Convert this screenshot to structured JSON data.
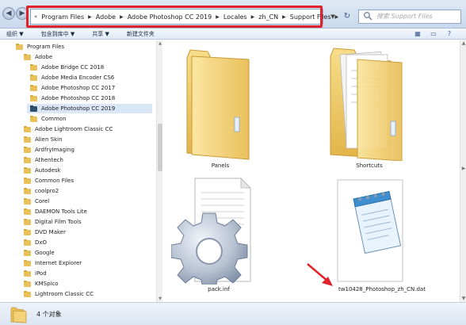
{
  "address": {
    "crumbs": [
      "Program Files",
      "Adobe",
      "Adobe Photoshop CC 2019",
      "Locales",
      "zh_CN",
      "Support Files"
    ]
  },
  "search": {
    "placeholder": "搜索 Support Files"
  },
  "toolbar": {
    "organize": "组织 ▼",
    "include_library": "包含到库中 ▼",
    "share": "共享 ▼",
    "new_folder": "新建文件夹"
  },
  "nav": {
    "items": [
      {
        "label": "Program Files",
        "level": 0
      },
      {
        "label": "Adobe",
        "level": 1
      },
      {
        "label": "Adobe Bridge CC 2018",
        "level": 2
      },
      {
        "label": "Adobe Media Encoder CS6",
        "level": 2
      },
      {
        "label": "Adobe Photoshop CC 2017",
        "level": 2
      },
      {
        "label": "Adobe Photoshop CC 2018",
        "level": 2
      },
      {
        "label": "Adobe Photoshop CC 2019",
        "level": 2,
        "selected": true
      },
      {
        "label": "Common",
        "level": 2
      },
      {
        "label": "Adobe Lightroom Classic CC",
        "level": 1
      },
      {
        "label": "Alien Skin",
        "level": 1
      },
      {
        "label": "ArdfryImaging",
        "level": 1
      },
      {
        "label": "Athentech",
        "level": 1
      },
      {
        "label": "Autodesk",
        "level": 1
      },
      {
        "label": "Common Files",
        "level": 1
      },
      {
        "label": "coolpro2",
        "level": 1
      },
      {
        "label": "Corel",
        "level": 1
      },
      {
        "label": "DAEMON Tools Lite",
        "level": 1
      },
      {
        "label": "Digital Film Tools",
        "level": 1
      },
      {
        "label": "DVD Maker",
        "level": 1
      },
      {
        "label": "DxO",
        "level": 1
      },
      {
        "label": "Google",
        "level": 1
      },
      {
        "label": "Internet Explorer",
        "level": 1
      },
      {
        "label": "iPod",
        "level": 1
      },
      {
        "label": "KMSpico",
        "level": 1
      },
      {
        "label": "Lightroom Classic CC",
        "level": 1
      }
    ]
  },
  "files": [
    {
      "name": "Panels",
      "kind": "folder"
    },
    {
      "name": "Shortcuts",
      "kind": "folder-docs"
    },
    {
      "name": "pack.inf",
      "kind": "inf"
    },
    {
      "name": "tw10428_Photoshop_zh_CN.dat",
      "kind": "dat"
    }
  ],
  "status": {
    "count": "4 个对象"
  },
  "colors": {
    "highlight": "#e0222a",
    "arrow": "#e0222a"
  }
}
